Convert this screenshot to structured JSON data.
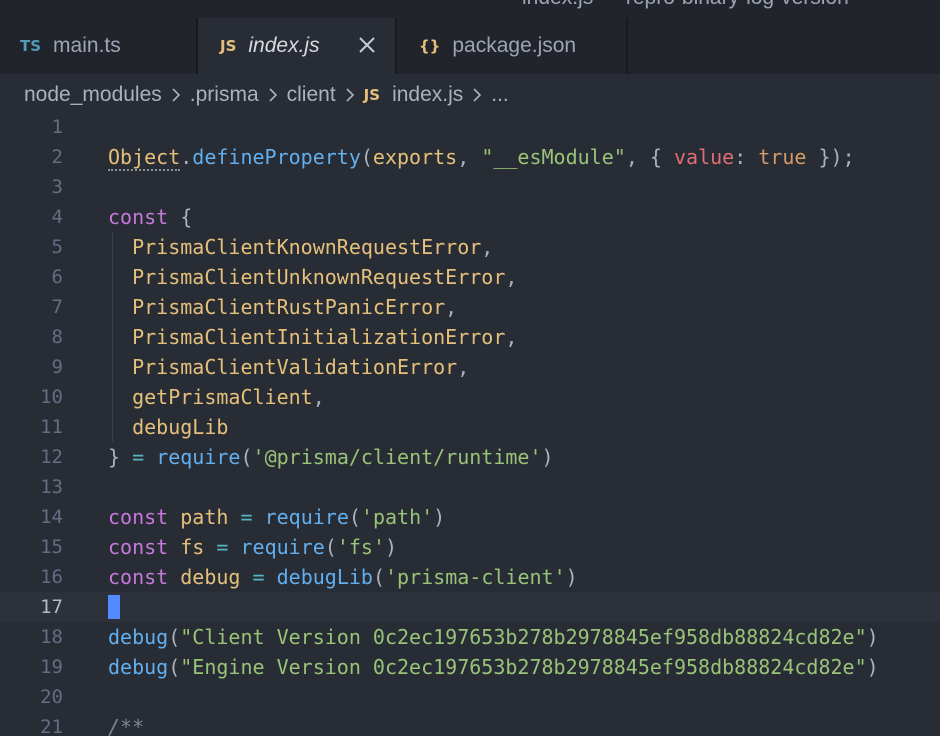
{
  "window": {
    "title": "index.js — repro-binary-log-version"
  },
  "tabs": [
    {
      "badge": "TS",
      "badge_color": "#519aba",
      "label": "main.ts",
      "active": false
    },
    {
      "badge": "JS",
      "badge_color": "#e5c07b",
      "label": "index.js",
      "active": true
    },
    {
      "badge": "{}",
      "badge_color": "#e5c07b",
      "label": "package.json",
      "active": false
    }
  ],
  "breadcrumb": {
    "items": [
      "node_modules",
      ".prisma",
      "client"
    ],
    "file_badge": "JS",
    "file": "index.js",
    "more": "..."
  },
  "editor": {
    "current_line": 17,
    "lines": [
      {
        "n": "1",
        "tokens": []
      },
      {
        "n": "2",
        "tokens": [
          {
            "t": "Object",
            "c": "obj"
          },
          {
            "t": ".",
            "c": "pl"
          },
          {
            "t": "defineProperty",
            "c": "fn"
          },
          {
            "t": "(",
            "c": "pl"
          },
          {
            "t": "exports",
            "c": "var"
          },
          {
            "t": ", ",
            "c": "pl"
          },
          {
            "t": "\"__esModule\"",
            "c": "str"
          },
          {
            "t": ", { ",
            "c": "pl"
          },
          {
            "t": "value",
            "c": "prop"
          },
          {
            "t": ": ",
            "c": "pl"
          },
          {
            "t": "true",
            "c": "boolv"
          },
          {
            "t": " });",
            "c": "pl"
          }
        ]
      },
      {
        "n": "3",
        "tokens": []
      },
      {
        "n": "4",
        "tokens": [
          {
            "t": "const",
            "c": "kw"
          },
          {
            "t": " {",
            "c": "pl"
          }
        ]
      },
      {
        "n": "5",
        "guide": true,
        "tokens": [
          {
            "t": "  ",
            "c": "pl"
          },
          {
            "t": "PrismaClientKnownRequestError",
            "c": "var"
          },
          {
            "t": ",",
            "c": "pl"
          }
        ]
      },
      {
        "n": "6",
        "guide": true,
        "tokens": [
          {
            "t": "  ",
            "c": "pl"
          },
          {
            "t": "PrismaClientUnknownRequestError",
            "c": "var"
          },
          {
            "t": ",",
            "c": "pl"
          }
        ]
      },
      {
        "n": "7",
        "guide": true,
        "tokens": [
          {
            "t": "  ",
            "c": "pl"
          },
          {
            "t": "PrismaClientRustPanicError",
            "c": "var"
          },
          {
            "t": ",",
            "c": "pl"
          }
        ]
      },
      {
        "n": "8",
        "guide": true,
        "tokens": [
          {
            "t": "  ",
            "c": "pl"
          },
          {
            "t": "PrismaClientInitializationError",
            "c": "var"
          },
          {
            "t": ",",
            "c": "pl"
          }
        ]
      },
      {
        "n": "9",
        "guide": true,
        "tokens": [
          {
            "t": "  ",
            "c": "pl"
          },
          {
            "t": "PrismaClientValidationError",
            "c": "var"
          },
          {
            "t": ",",
            "c": "pl"
          }
        ]
      },
      {
        "n": "10",
        "guide": true,
        "tokens": [
          {
            "t": "  ",
            "c": "pl"
          },
          {
            "t": "getPrismaClient",
            "c": "var"
          },
          {
            "t": ",",
            "c": "pl"
          }
        ]
      },
      {
        "n": "11",
        "guide": true,
        "tokens": [
          {
            "t": "  ",
            "c": "pl"
          },
          {
            "t": "debugLib",
            "c": "var"
          }
        ]
      },
      {
        "n": "12",
        "tokens": [
          {
            "t": "} ",
            "c": "pl"
          },
          {
            "t": "=",
            "c": "op"
          },
          {
            "t": " ",
            "c": "pl"
          },
          {
            "t": "require",
            "c": "fn"
          },
          {
            "t": "(",
            "c": "pl"
          },
          {
            "t": "'@prisma/client/runtime'",
            "c": "str"
          },
          {
            "t": ")",
            "c": "pl"
          }
        ]
      },
      {
        "n": "13",
        "tokens": []
      },
      {
        "n": "14",
        "tokens": [
          {
            "t": "const",
            "c": "kw"
          },
          {
            "t": " ",
            "c": "pl"
          },
          {
            "t": "path",
            "c": "var"
          },
          {
            "t": " ",
            "c": "pl"
          },
          {
            "t": "=",
            "c": "op"
          },
          {
            "t": " ",
            "c": "pl"
          },
          {
            "t": "require",
            "c": "fn"
          },
          {
            "t": "(",
            "c": "pl"
          },
          {
            "t": "'path'",
            "c": "str"
          },
          {
            "t": ")",
            "c": "pl"
          }
        ]
      },
      {
        "n": "15",
        "tokens": [
          {
            "t": "const",
            "c": "kw"
          },
          {
            "t": " ",
            "c": "pl"
          },
          {
            "t": "fs",
            "c": "var"
          },
          {
            "t": " ",
            "c": "pl"
          },
          {
            "t": "=",
            "c": "op"
          },
          {
            "t": " ",
            "c": "pl"
          },
          {
            "t": "require",
            "c": "fn"
          },
          {
            "t": "(",
            "c": "pl"
          },
          {
            "t": "'fs'",
            "c": "str"
          },
          {
            "t": ")",
            "c": "pl"
          }
        ]
      },
      {
        "n": "16",
        "tokens": [
          {
            "t": "const",
            "c": "kw"
          },
          {
            "t": " ",
            "c": "pl"
          },
          {
            "t": "debug",
            "c": "var"
          },
          {
            "t": " ",
            "c": "pl"
          },
          {
            "t": "=",
            "c": "op"
          },
          {
            "t": " ",
            "c": "pl"
          },
          {
            "t": "debugLib",
            "c": "fn"
          },
          {
            "t": "(",
            "c": "pl"
          },
          {
            "t": "'prisma-client'",
            "c": "str"
          },
          {
            "t": ")",
            "c": "pl"
          }
        ]
      },
      {
        "n": "17",
        "tokens": []
      },
      {
        "n": "18",
        "tokens": [
          {
            "t": "debug",
            "c": "fn"
          },
          {
            "t": "(",
            "c": "pl"
          },
          {
            "t": "\"Client Version 0c2ec197653b278b2978845ef958db88824cd82e\"",
            "c": "str"
          },
          {
            "t": ")",
            "c": "pl"
          }
        ]
      },
      {
        "n": "19",
        "tokens": [
          {
            "t": "debug",
            "c": "fn"
          },
          {
            "t": "(",
            "c": "pl"
          },
          {
            "t": "\"Engine Version 0c2ec197653b278b2978845ef958db88824cd82e\"",
            "c": "str"
          },
          {
            "t": ")",
            "c": "pl"
          }
        ]
      },
      {
        "n": "20",
        "tokens": []
      },
      {
        "n": "21",
        "tokens": [
          {
            "t": "/**",
            "c": "cmt"
          }
        ]
      }
    ]
  }
}
